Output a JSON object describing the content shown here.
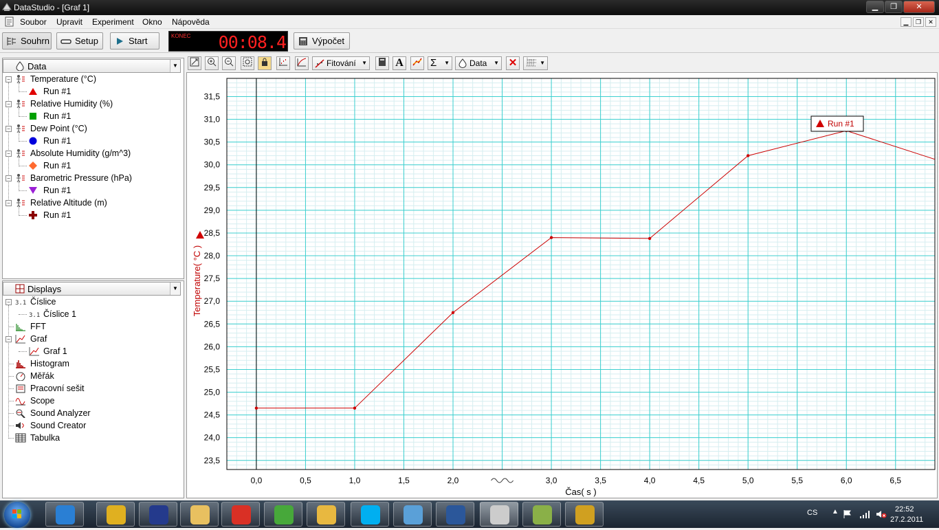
{
  "window": {
    "title": "DataStudio - [Graf 1]"
  },
  "menu": [
    "Soubor",
    "Upravit",
    "Experiment",
    "Okno",
    "Nápověda"
  ],
  "toolbar": {
    "summary": "Souhrn",
    "setup": "Setup",
    "start": "Start",
    "calc": "Výpočet"
  },
  "clock": {
    "status": "KONEC",
    "time": "00:08.4"
  },
  "data_panel": {
    "title": "Data",
    "items": [
      {
        "label": "Temperature (°C)",
        "run": "Run #1",
        "marker": "triangle",
        "color": "#e00000"
      },
      {
        "label": "Relative Humidity (%)",
        "run": "Run #1",
        "marker": "square",
        "color": "#00a000"
      },
      {
        "label": "Dew Point (°C)",
        "run": "Run #1",
        "marker": "circle",
        "color": "#0000dd"
      },
      {
        "label": "Absolute Humidity (g/m^3)",
        "run": "Run #1",
        "marker": "diamond",
        "color": "#ff6a30"
      },
      {
        "label": "Barometric Pressure (hPa)",
        "run": "Run #1",
        "marker": "triangle-down",
        "color": "#9b1fd6"
      },
      {
        "label": "Relative Altitude (m)",
        "run": "Run #1",
        "marker": "cross",
        "color": "#8b0000"
      }
    ]
  },
  "displays_panel": {
    "title": "Displays",
    "items": [
      {
        "label": "Číslice",
        "icon": "digits-icon",
        "children": [
          "Číslice 1"
        ]
      },
      {
        "label": "FFT",
        "icon": "fft-icon"
      },
      {
        "label": "Graf",
        "icon": "graph-icon",
        "children": [
          "Graf 1"
        ]
      },
      {
        "label": "Histogram",
        "icon": "histogram-icon"
      },
      {
        "label": "Měřák",
        "icon": "meter-icon"
      },
      {
        "label": "Pracovní sešit",
        "icon": "workbook-icon"
      },
      {
        "label": "Scope",
        "icon": "scope-icon"
      },
      {
        "label": "Sound Analyzer",
        "icon": "sound-analyzer-icon"
      },
      {
        "label": "Sound Creator",
        "icon": "sound-creator-icon"
      },
      {
        "label": "Tabulka",
        "icon": "table-icon"
      }
    ]
  },
  "graph_toolbar": {
    "fit": "Fitování",
    "data": "Data"
  },
  "chart_data": {
    "type": "line",
    "xlabel": "Čas( s )",
    "ylabel": "Temperature( °C )",
    "legend": "Run #1",
    "legend_position": "top-right",
    "xlim": [
      -0.3,
      6.9
    ],
    "ylim": [
      23.3,
      31.9
    ],
    "xticks": [
      "0,0",
      "0,5",
      "1,0",
      "1,5",
      "2,0",
      "2,5",
      "3,0",
      "3,5",
      "4,0",
      "4,5",
      "5,0",
      "5,5",
      "6,0",
      "6,5"
    ],
    "yticks": [
      "23,5",
      "24,0",
      "24,5",
      "25,0",
      "25,5",
      "26,0",
      "26,5",
      "27,0",
      "27,5",
      "28,0",
      "28,5",
      "29,0",
      "29,5",
      "30,0",
      "30,5",
      "31,0",
      "31,5"
    ],
    "series": [
      {
        "name": "Run #1",
        "color": "#cc0000",
        "x": [
          0,
          1,
          2,
          3,
          4,
          5,
          6,
          7
        ],
        "y": [
          24.65,
          24.65,
          26.75,
          28.4,
          28.38,
          30.2,
          30.75,
          30.05
        ]
      }
    ],
    "grid": true
  },
  "taskbar": {
    "lang": "CS",
    "time": "22:52",
    "date": "27.2.2011",
    "apps": [
      "ie-icon",
      "chrome-icon",
      "save-icon",
      "explorer-icon",
      "gmail-icon",
      "greenshot-icon",
      "outlook-icon",
      "skype-icon",
      "messenger-icon",
      "word-icon",
      "datastudio-icon",
      "paint-icon",
      "video-icon"
    ]
  }
}
